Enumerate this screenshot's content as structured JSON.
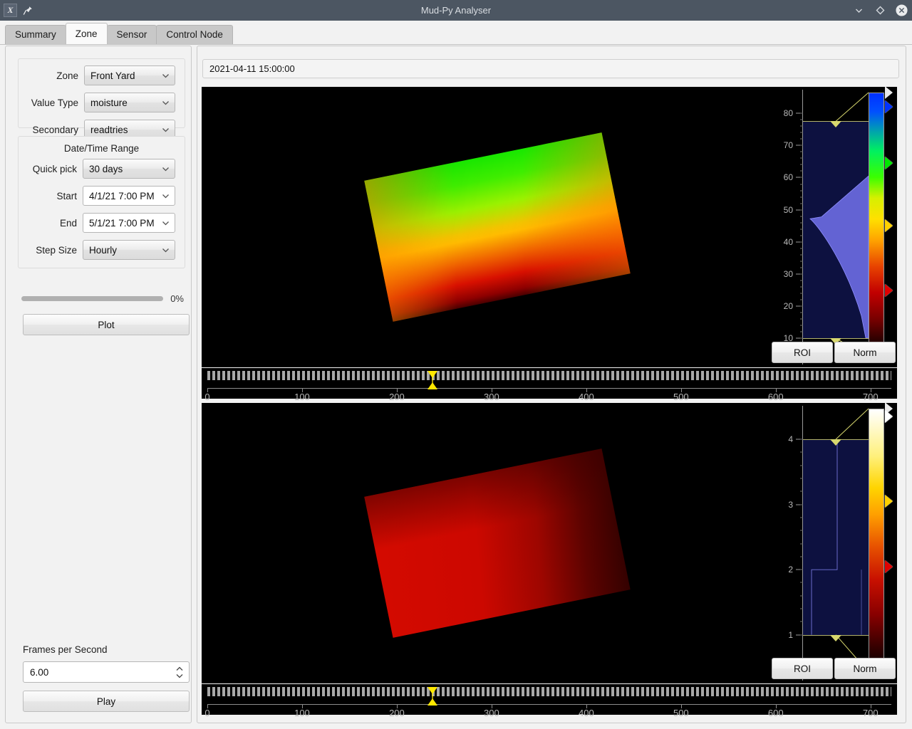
{
  "window": {
    "title": "Mud-Py Analyser",
    "app_icon": "x-app-icon",
    "pin_icon": "pin-icon",
    "minimize_icon": "chevron-down-icon",
    "maximize_icon": "diamond-icon",
    "close_icon": "close-circle-icon"
  },
  "tabs": [
    {
      "label": "Summary",
      "active": false
    },
    {
      "label": "Zone",
      "active": true
    },
    {
      "label": "Sensor",
      "active": false
    },
    {
      "label": "Control Node",
      "active": false
    }
  ],
  "sidebar": {
    "selection": {
      "fields": [
        {
          "label": "Zone",
          "value": "Front Yard",
          "editable": false
        },
        {
          "label": "Value Type",
          "value": "moisture",
          "editable": false
        },
        {
          "label": "Secondary",
          "value": "readtries",
          "editable": false
        }
      ]
    },
    "datetime": {
      "title": "Date/Time Range",
      "fields": [
        {
          "label": "Quick pick",
          "value": "30 days",
          "editable": false
        },
        {
          "label": "Start",
          "value": "4/1/21 7:00 PM",
          "editable": true
        },
        {
          "label": "End",
          "value": "5/1/21 7:00 PM",
          "editable": true
        },
        {
          "label": "Step Size",
          "value": "Hourly",
          "editable": false
        }
      ]
    },
    "progress": {
      "percent_label": "0%",
      "percent": 0
    },
    "plot_button": "Plot",
    "fps": {
      "label": "Frames per Second",
      "value": "6.00"
    },
    "play_button": "Play"
  },
  "plots": {
    "timestamp": "2021-04-11 15:00:00",
    "top": {
      "name": "moisture-image-plot",
      "colormap": "rainbow",
      "lut": {
        "axis_ticks": [
          10,
          20,
          30,
          40,
          50,
          60,
          70,
          80
        ],
        "axis_min": 5,
        "axis_max": 86,
        "roi_low": 10.0,
        "roi_high": 77.5,
        "handles": [
          {
            "position": 82.0,
            "color": "#0033ff"
          },
          {
            "position": 64.5,
            "color": "#00e800"
          },
          {
            "position": 45.0,
            "color": "#ffd000"
          },
          {
            "position": 25.0,
            "color": "#e00000"
          }
        ],
        "histogram_peak": 47.5
      },
      "buttons": {
        "roi": "ROI",
        "norm": "Norm"
      },
      "timeline": {
        "ticks": [
          0,
          100,
          200,
          300,
          400,
          500,
          600,
          700
        ],
        "max": 722,
        "playhead": 238
      }
    },
    "bottom": {
      "name": "readtries-image-plot",
      "colormap": "hot",
      "lut": {
        "axis_ticks": [
          1,
          2,
          3,
          4
        ],
        "axis_min": 0.45,
        "axis_max": 4.45,
        "roi_low": 1.0,
        "roi_high": 4.0,
        "handles": [
          {
            "position": 4.35,
            "color": "#ffffff"
          },
          {
            "position": 3.05,
            "color": "#ffd000"
          },
          {
            "position": 2.05,
            "color": "#e00000"
          }
        ],
        "histogram_step": 2.0
      },
      "buttons": {
        "roi": "ROI",
        "norm": "Norm"
      },
      "timeline": {
        "ticks": [
          0,
          100,
          200,
          300,
          400,
          500,
          600,
          700
        ],
        "max": 722,
        "playhead": 238
      }
    }
  },
  "colors": {
    "titlebar": "#4c5662",
    "window_bg": "#f2f2f2",
    "plot_bg": "#000000",
    "hist_fill": "#0d1140",
    "roi_line": "#b3b36b",
    "playhead": "#ffe800"
  }
}
